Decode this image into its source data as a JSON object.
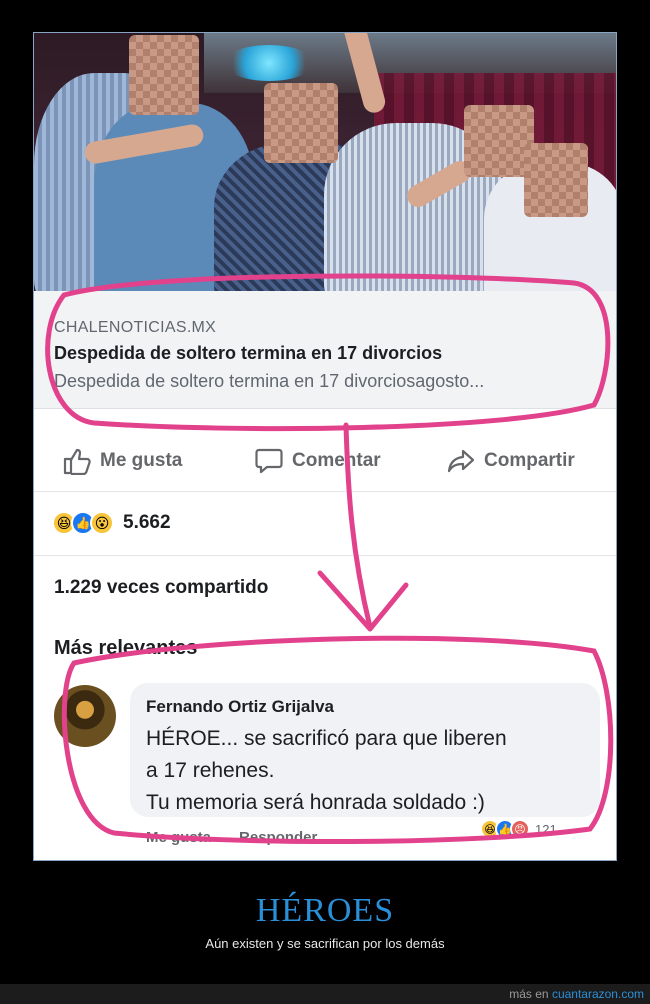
{
  "post": {
    "link": {
      "domain": "CHALENOTICIAS.MX",
      "title": "Despedida de soltero termina en 17 divorcios",
      "description": "Despedida de soltero termina en 17 divorciosagosto..."
    },
    "actions": {
      "like": "Me gusta",
      "comment": "Comentar",
      "share": "Compartir"
    },
    "reactions": {
      "icons": [
        "haha-icon",
        "like-icon",
        "wow-icon"
      ],
      "count": "5.662"
    },
    "shares": "1.229 veces compartido",
    "comments_header": "Más relevantes",
    "comment": {
      "author": "Fernando Ortiz Grijalva",
      "lines": [
        "HÉROE... se sacrificó para que liberen",
        "a 17 rehenes.",
        "Tu memoria será honrada soldado  :)"
      ],
      "like": "Me gusta",
      "reply": "Responder",
      "reaction_count": "121"
    }
  },
  "footer": {
    "title": "HÉROES",
    "subtitle": "Aún existen y se sacrifican por los demás",
    "credit_prefix": "más en",
    "credit_site": "cuantarazon.com"
  },
  "colors": {
    "marker": "#e2418c",
    "footer_title": "#2b8fd8",
    "facebook_blue": "#1877f2"
  }
}
